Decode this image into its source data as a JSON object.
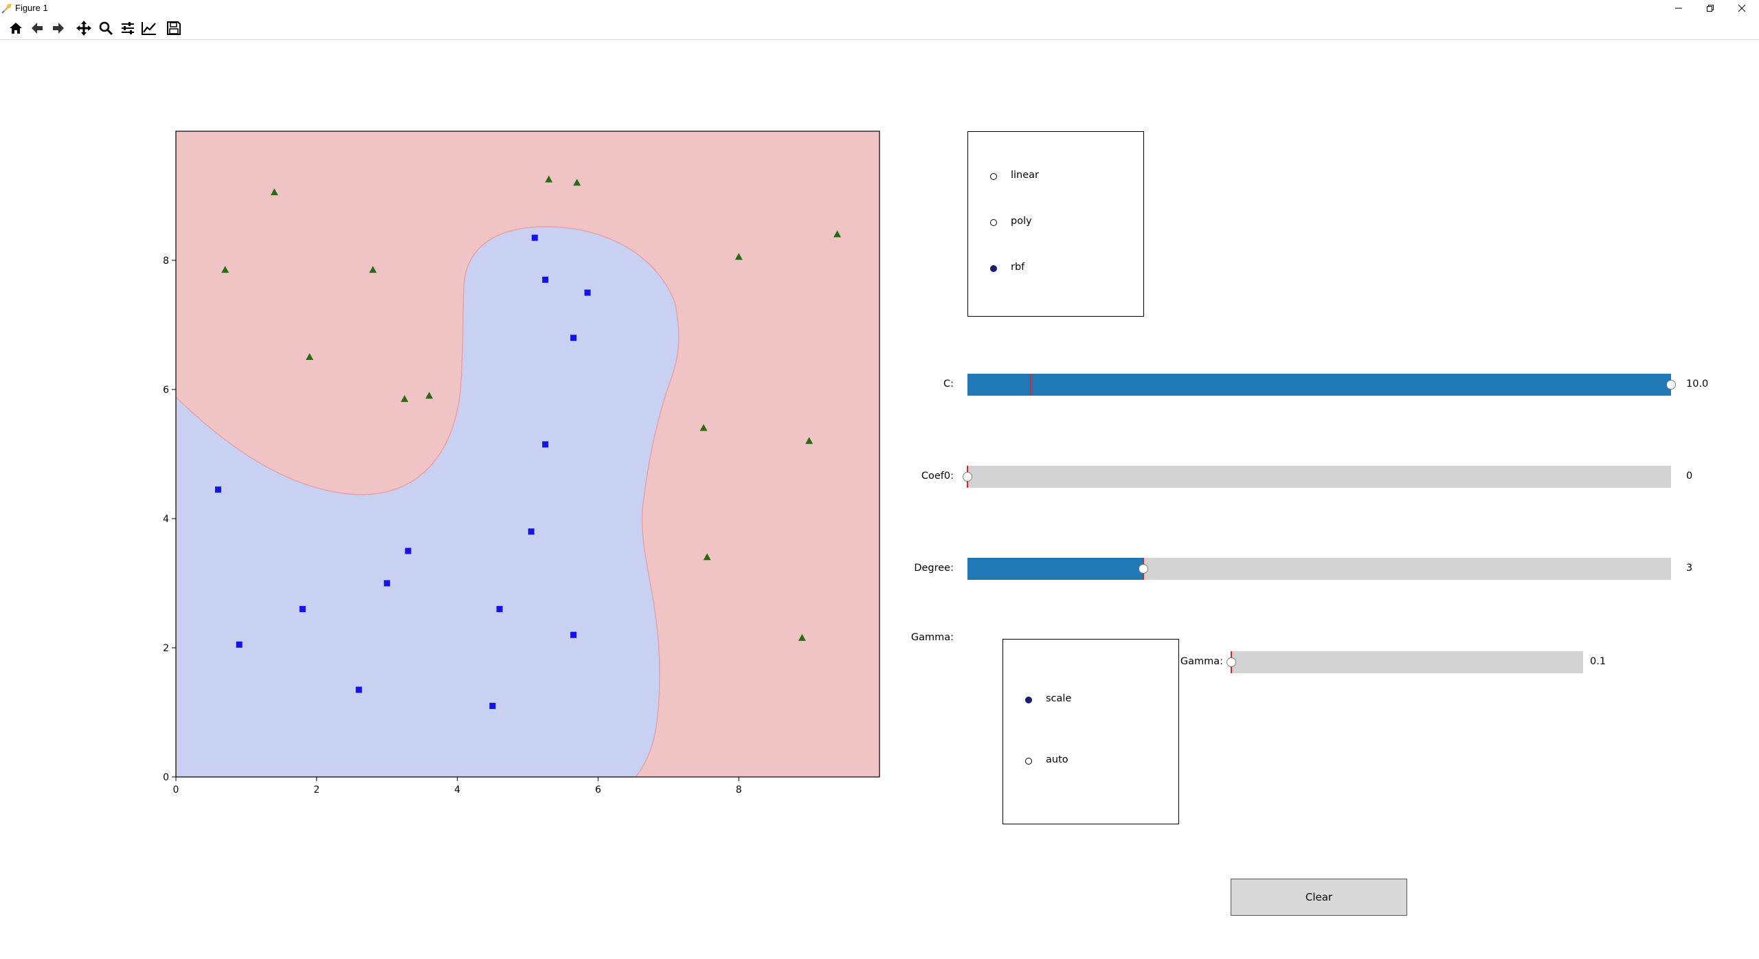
{
  "window": {
    "title": "Figure 1"
  },
  "toolbar": {
    "tools": [
      {
        "name": "home-icon"
      },
      {
        "name": "back-icon"
      },
      {
        "name": "forward-icon"
      },
      {
        "name": "pan-icon"
      },
      {
        "name": "zoom-icon"
      },
      {
        "name": "configure-subplots-icon"
      },
      {
        "name": "edit-axis-icon"
      },
      {
        "name": "save-icon"
      }
    ]
  },
  "plot": {
    "x_ticks": [
      "0",
      "2",
      "4",
      "6",
      "8"
    ],
    "y_ticks": [
      "0",
      "2",
      "4",
      "6",
      "8"
    ],
    "colors": {
      "region_a": "#f0c4c4",
      "region_b": "#c9d1f2",
      "boundary": "#e8a0a8",
      "square": "#1414e6",
      "triangle": "#2a6a12"
    }
  },
  "chart_data": {
    "type": "scatter",
    "xlim": [
      0,
      10
    ],
    "ylim": [
      0,
      10
    ],
    "grid": false,
    "series": [
      {
        "marker": "square",
        "color": "#1414e6",
        "points": [
          [
            5.1,
            8.35
          ],
          [
            5.25,
            7.7
          ],
          [
            5.85,
            7.5
          ],
          [
            5.65,
            6.8
          ],
          [
            5.25,
            5.15
          ],
          [
            0.6,
            4.45
          ],
          [
            5.05,
            3.8
          ],
          [
            3.3,
            3.5
          ],
          [
            3.0,
            3.0
          ],
          [
            1.8,
            2.6
          ],
          [
            4.6,
            2.6
          ],
          [
            5.65,
            2.2
          ],
          [
            0.9,
            2.05
          ],
          [
            2.6,
            1.35
          ],
          [
            4.5,
            1.1
          ]
        ]
      },
      {
        "marker": "triangle",
        "color": "#2a6a12",
        "points": [
          [
            1.4,
            9.05
          ],
          [
            5.3,
            9.25
          ],
          [
            5.7,
            9.2
          ],
          [
            9.4,
            8.4
          ],
          [
            0.7,
            7.85
          ],
          [
            2.8,
            7.85
          ],
          [
            8.0,
            8.05
          ],
          [
            1.9,
            6.5
          ],
          [
            3.25,
            5.85
          ],
          [
            3.6,
            5.9
          ],
          [
            7.5,
            5.4
          ],
          [
            9.0,
            5.2
          ],
          [
            7.55,
            3.4
          ],
          [
            8.9,
            2.15
          ]
        ]
      }
    ]
  },
  "kernel_radio": {
    "options": [
      {
        "label": "linear",
        "selected": false
      },
      {
        "label": "poly",
        "selected": false
      },
      {
        "label": "rbf",
        "selected": true
      }
    ]
  },
  "sliders": {
    "c": {
      "label": "C:",
      "value_text": "10.0",
      "fill_fraction": 1.0,
      "init_fraction": 0.09
    },
    "coef0": {
      "label": "Coef0:",
      "value_text": "0",
      "fill_fraction": 0.0,
      "init_fraction": 0.0
    },
    "degree": {
      "label": "Degree:",
      "value_text": "3",
      "fill_fraction": 0.25,
      "init_fraction": 0.25
    },
    "gamma": {
      "label": "Gamma:",
      "value_text": "0.1",
      "fill_fraction": 0.0,
      "init_fraction": 0.0
    }
  },
  "gamma_section": {
    "label": "Gamma:"
  },
  "gamma_radio": {
    "options": [
      {
        "label": "scale",
        "selected": true
      },
      {
        "label": "auto",
        "selected": false
      }
    ]
  },
  "clear_button": {
    "label": "Clear"
  }
}
